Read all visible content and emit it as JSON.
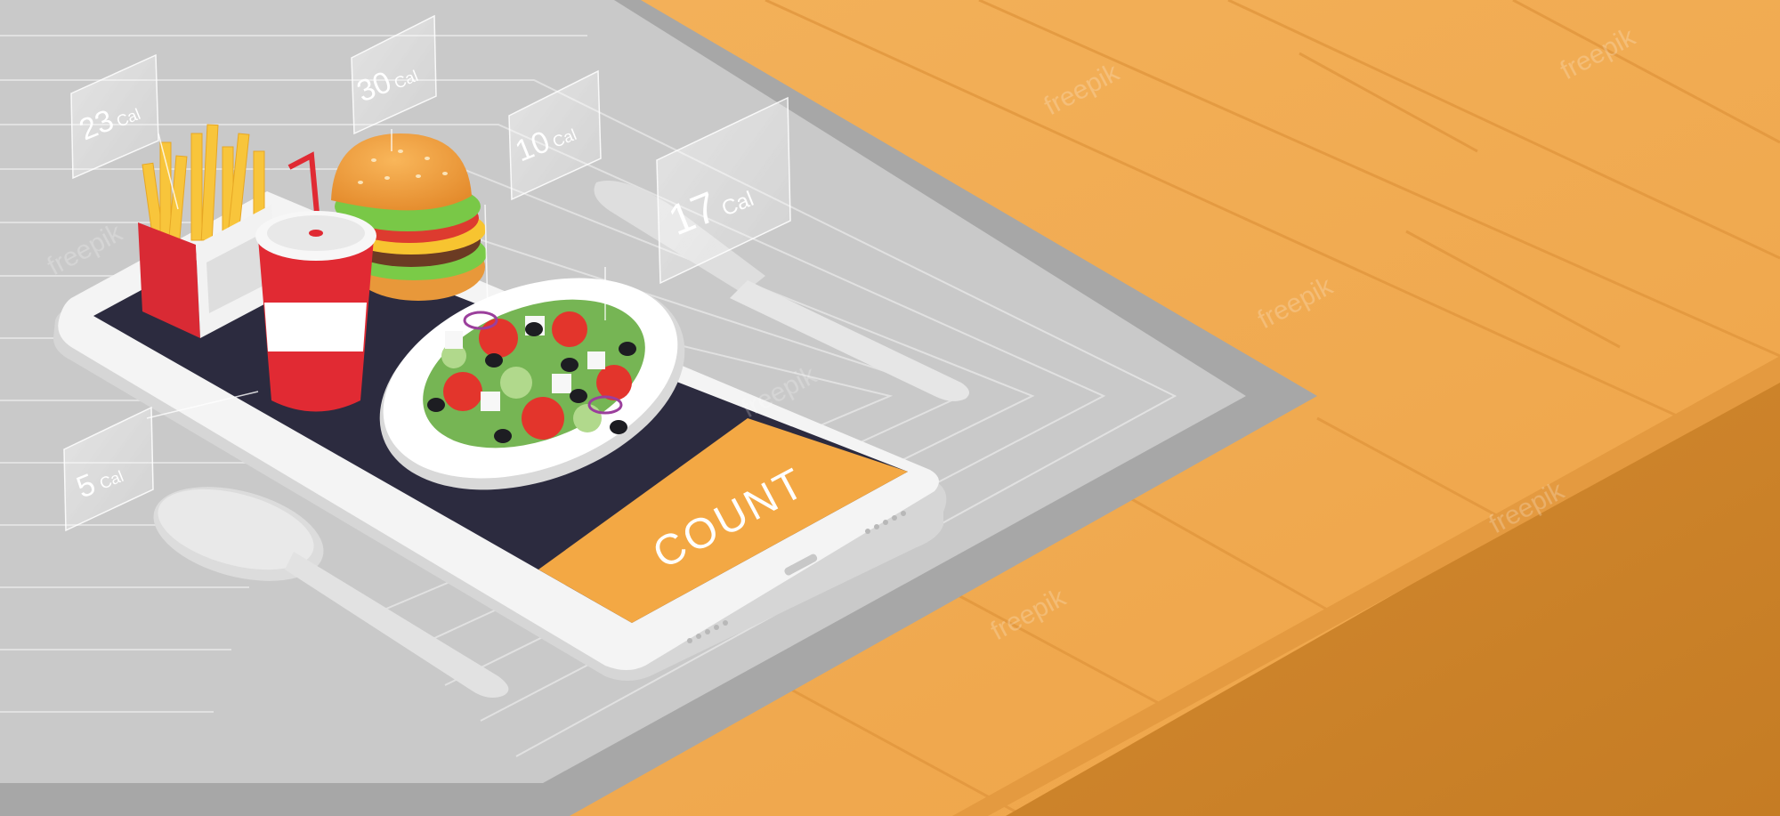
{
  "calorie_labels": [
    {
      "value": "23",
      "unit": "Cal"
    },
    {
      "value": "30",
      "unit": "Cal"
    },
    {
      "value": "10",
      "unit": "Cal"
    },
    {
      "value": "17",
      "unit": "Cal"
    },
    {
      "value": "5",
      "unit": "Cal"
    }
  ],
  "app": {
    "button_label": "COUNT"
  },
  "watermark": {
    "brand": "freepik"
  },
  "colors": {
    "table_wood": "#f2ad55",
    "table_wood_dark": "#d88b31",
    "table_edge": "#c98024",
    "placemat_gray": "#9a9a9a",
    "placemat_light": "#d5d5d5",
    "phone_screen": "#2c2b3f",
    "phone_body": "#f4f4f4",
    "accent_orange": "#f3a844",
    "cup_red": "#e12a33",
    "fries_yellow": "#f8c53b"
  },
  "icons": [
    "spoon-icon",
    "knife-icon",
    "burger-icon",
    "fries-icon",
    "soda-cup-icon",
    "salad-plate-icon",
    "phone-icon"
  ]
}
